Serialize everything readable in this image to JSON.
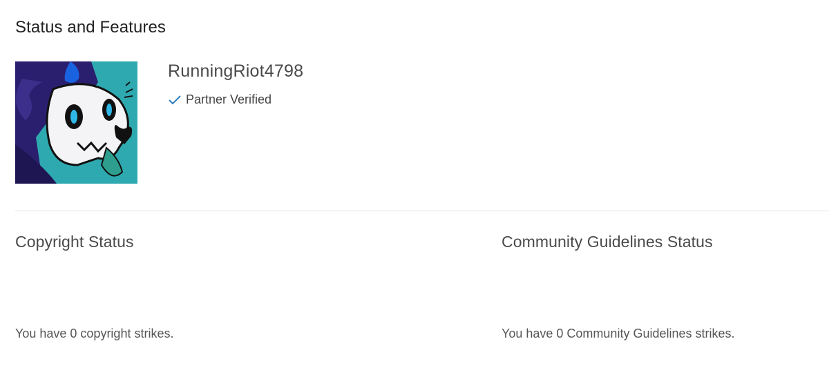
{
  "page": {
    "title": "Status and Features"
  },
  "channel": {
    "name": "RunningRiot4798",
    "verified_label": "Partner Verified",
    "avatar_icon": "skull-character-avatar"
  },
  "copyright": {
    "title": "Copyright Status",
    "message": "You have 0 copyright strikes."
  },
  "community": {
    "title": "Community Guidelines Status",
    "message": "You have 0 Community Guidelines strikes."
  },
  "colors": {
    "verified_check": "#2b7bbf",
    "avatar_bg": "#2ea9b0",
    "avatar_hood": "#2a1f6e",
    "divider": "#e0e0e0"
  }
}
